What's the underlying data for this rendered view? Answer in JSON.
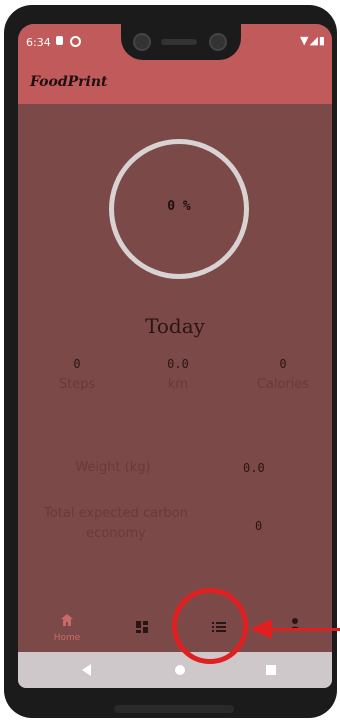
{
  "status_bar": {
    "time": "6:34",
    "right_icons": "▼◢▮"
  },
  "app_bar": {
    "title": "FoodPrint"
  },
  "progress": {
    "label": "0 %",
    "value_percent": 0
  },
  "section_title": "Today",
  "stats": [
    {
      "value": "0",
      "label": "Steps"
    },
    {
      "value": "0.0",
      "label": "km"
    },
    {
      "value": "0",
      "label": "Calories"
    }
  ],
  "weight": {
    "label": "Weight (kg)",
    "value": "0.0"
  },
  "carbon": {
    "label_line1": "Total expected carbon",
    "label_line2": "economy",
    "value": "0"
  },
  "bottom_nav": {
    "home_label": "Home",
    "icons": [
      "home-icon",
      "dashboard-icon",
      "list-icon",
      "profile-icon"
    ]
  },
  "colors": {
    "screen_bg": "#7b4a48",
    "app_bar": "#c15a5a",
    "highlight": "#e02020"
  }
}
